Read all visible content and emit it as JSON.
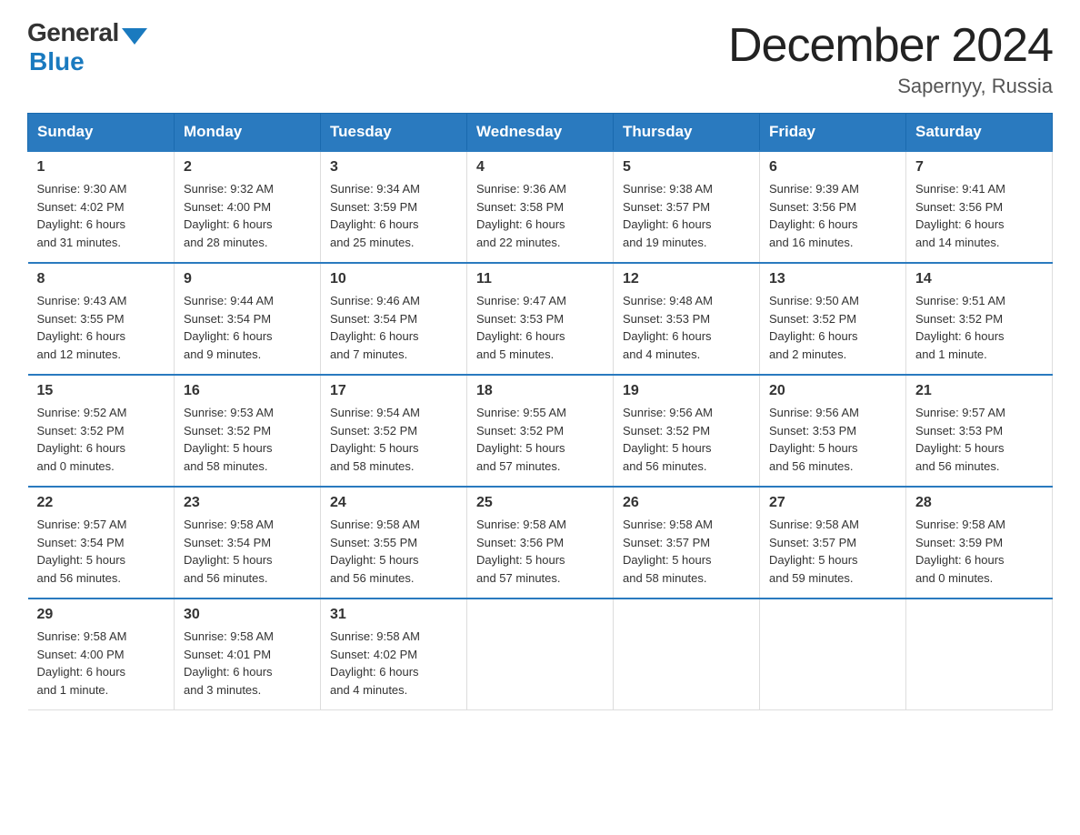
{
  "logo": {
    "general": "General",
    "blue": "Blue"
  },
  "title": "December 2024",
  "location": "Sapernyy, Russia",
  "weekdays": [
    "Sunday",
    "Monday",
    "Tuesday",
    "Wednesday",
    "Thursday",
    "Friday",
    "Saturday"
  ],
  "weeks": [
    [
      {
        "day": "1",
        "sunrise": "9:30 AM",
        "sunset": "4:02 PM",
        "daylight": "6 hours and 31 minutes."
      },
      {
        "day": "2",
        "sunrise": "9:32 AM",
        "sunset": "4:00 PM",
        "daylight": "6 hours and 28 minutes."
      },
      {
        "day": "3",
        "sunrise": "9:34 AM",
        "sunset": "3:59 PM",
        "daylight": "6 hours and 25 minutes."
      },
      {
        "day": "4",
        "sunrise": "9:36 AM",
        "sunset": "3:58 PM",
        "daylight": "6 hours and 22 minutes."
      },
      {
        "day": "5",
        "sunrise": "9:38 AM",
        "sunset": "3:57 PM",
        "daylight": "6 hours and 19 minutes."
      },
      {
        "day": "6",
        "sunrise": "9:39 AM",
        "sunset": "3:56 PM",
        "daylight": "6 hours and 16 minutes."
      },
      {
        "day": "7",
        "sunrise": "9:41 AM",
        "sunset": "3:56 PM",
        "daylight": "6 hours and 14 minutes."
      }
    ],
    [
      {
        "day": "8",
        "sunrise": "9:43 AM",
        "sunset": "3:55 PM",
        "daylight": "6 hours and 12 minutes."
      },
      {
        "day": "9",
        "sunrise": "9:44 AM",
        "sunset": "3:54 PM",
        "daylight": "6 hours and 9 minutes."
      },
      {
        "day": "10",
        "sunrise": "9:46 AM",
        "sunset": "3:54 PM",
        "daylight": "6 hours and 7 minutes."
      },
      {
        "day": "11",
        "sunrise": "9:47 AM",
        "sunset": "3:53 PM",
        "daylight": "6 hours and 5 minutes."
      },
      {
        "day": "12",
        "sunrise": "9:48 AM",
        "sunset": "3:53 PM",
        "daylight": "6 hours and 4 minutes."
      },
      {
        "day": "13",
        "sunrise": "9:50 AM",
        "sunset": "3:52 PM",
        "daylight": "6 hours and 2 minutes."
      },
      {
        "day": "14",
        "sunrise": "9:51 AM",
        "sunset": "3:52 PM",
        "daylight": "6 hours and 1 minute."
      }
    ],
    [
      {
        "day": "15",
        "sunrise": "9:52 AM",
        "sunset": "3:52 PM",
        "daylight": "6 hours and 0 minutes."
      },
      {
        "day": "16",
        "sunrise": "9:53 AM",
        "sunset": "3:52 PM",
        "daylight": "5 hours and 58 minutes."
      },
      {
        "day": "17",
        "sunrise": "9:54 AM",
        "sunset": "3:52 PM",
        "daylight": "5 hours and 58 minutes."
      },
      {
        "day": "18",
        "sunrise": "9:55 AM",
        "sunset": "3:52 PM",
        "daylight": "5 hours and 57 minutes."
      },
      {
        "day": "19",
        "sunrise": "9:56 AM",
        "sunset": "3:52 PM",
        "daylight": "5 hours and 56 minutes."
      },
      {
        "day": "20",
        "sunrise": "9:56 AM",
        "sunset": "3:53 PM",
        "daylight": "5 hours and 56 minutes."
      },
      {
        "day": "21",
        "sunrise": "9:57 AM",
        "sunset": "3:53 PM",
        "daylight": "5 hours and 56 minutes."
      }
    ],
    [
      {
        "day": "22",
        "sunrise": "9:57 AM",
        "sunset": "3:54 PM",
        "daylight": "5 hours and 56 minutes."
      },
      {
        "day": "23",
        "sunrise": "9:58 AM",
        "sunset": "3:54 PM",
        "daylight": "5 hours and 56 minutes."
      },
      {
        "day": "24",
        "sunrise": "9:58 AM",
        "sunset": "3:55 PM",
        "daylight": "5 hours and 56 minutes."
      },
      {
        "day": "25",
        "sunrise": "9:58 AM",
        "sunset": "3:56 PM",
        "daylight": "5 hours and 57 minutes."
      },
      {
        "day": "26",
        "sunrise": "9:58 AM",
        "sunset": "3:57 PM",
        "daylight": "5 hours and 58 minutes."
      },
      {
        "day": "27",
        "sunrise": "9:58 AM",
        "sunset": "3:57 PM",
        "daylight": "5 hours and 59 minutes."
      },
      {
        "day": "28",
        "sunrise": "9:58 AM",
        "sunset": "3:59 PM",
        "daylight": "6 hours and 0 minutes."
      }
    ],
    [
      {
        "day": "29",
        "sunrise": "9:58 AM",
        "sunset": "4:00 PM",
        "daylight": "6 hours and 1 minute."
      },
      {
        "day": "30",
        "sunrise": "9:58 AM",
        "sunset": "4:01 PM",
        "daylight": "6 hours and 3 minutes."
      },
      {
        "day": "31",
        "sunrise": "9:58 AM",
        "sunset": "4:02 PM",
        "daylight": "6 hours and 4 minutes."
      },
      null,
      null,
      null,
      null
    ]
  ]
}
